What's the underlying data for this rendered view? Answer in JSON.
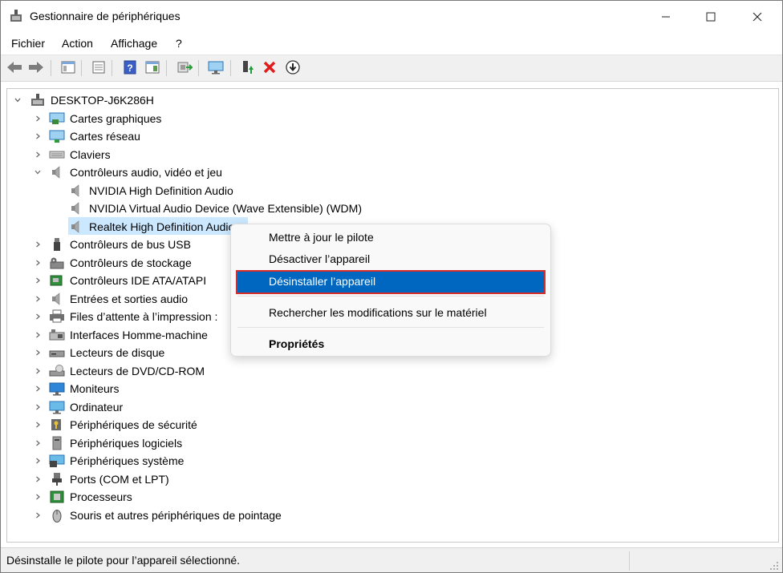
{
  "window": {
    "title": "Gestionnaire de périphériques"
  },
  "menu": [
    "Fichier",
    "Action",
    "Affichage",
    "?"
  ],
  "toolbar": {
    "buttons": [
      "back-icon",
      "forward-icon",
      "show-hide-tree-icon",
      "properties-icon",
      "help-icon",
      "view-icon",
      "scan-hardware-icon",
      "monitor-icon",
      "update-driver-icon",
      "uninstall-icon",
      "disable-icon"
    ],
    "colors": {
      "uninstall": "#e01b1b",
      "update": "#1e9e3a"
    }
  },
  "tree": {
    "root": "DESKTOP-J6K286H",
    "categories": [
      {
        "label": "Cartes graphiques",
        "icon": "display-adapter-icon"
      },
      {
        "label": "Cartes réseau",
        "icon": "network-adapter-icon"
      },
      {
        "label": "Claviers",
        "icon": "keyboard-icon"
      },
      {
        "label": "Contrôleurs audio, vidéo et jeu",
        "icon": "speaker-icon",
        "expanded": true,
        "children": [
          "NVIDIA High Definition Audio",
          "NVIDIA Virtual Audio Device (Wave Extensible) (WDM)",
          "Realtek High Definition Audio"
        ]
      },
      {
        "label": "Contrôleurs de bus USB",
        "icon": "usb-icon"
      },
      {
        "label": "Contrôleurs de stockage",
        "icon": "storage-controller-icon"
      },
      {
        "label": "Contrôleurs IDE ATA/ATAPI",
        "icon": "ide-controller-icon"
      },
      {
        "label": "Entrées et sorties audio",
        "icon": "audio-io-icon"
      },
      {
        "label": "Files d’attente à l’impression :",
        "icon": "printer-icon"
      },
      {
        "label": "Interfaces Homme-machine",
        "icon": "hid-icon"
      },
      {
        "label": "Lecteurs de disque",
        "icon": "disk-drive-icon"
      },
      {
        "label": "Lecteurs de DVD/CD-ROM",
        "icon": "dvd-drive-icon"
      },
      {
        "label": "Moniteurs",
        "icon": "monitor-icon"
      },
      {
        "label": "Ordinateur",
        "icon": "computer-icon"
      },
      {
        "label": "Périphériques de sécurité",
        "icon": "security-device-icon"
      },
      {
        "label": "Périphériques logiciels",
        "icon": "software-device-icon"
      },
      {
        "label": "Périphériques système",
        "icon": "system-device-icon"
      },
      {
        "label": "Ports (COM et LPT)",
        "icon": "port-icon"
      },
      {
        "label": "Processeurs",
        "icon": "processor-icon"
      },
      {
        "label": "Souris et autres périphériques de pointage",
        "icon": "mouse-icon"
      }
    ],
    "selected": "Realtek High Definition Audio"
  },
  "context_menu": {
    "items": [
      "Mettre à jour le pilote",
      "Désactiver l’appareil",
      "Désinstaller l’appareil",
      "Rechercher les modifications sur le matériel",
      "Propriétés"
    ],
    "highlighted": "Désinstaller l’appareil",
    "highlight_color": "#0067c0",
    "outline_color": "#d62d2d"
  },
  "status": {
    "text": "Désinstalle le pilote pour l’appareil sélectionné."
  }
}
